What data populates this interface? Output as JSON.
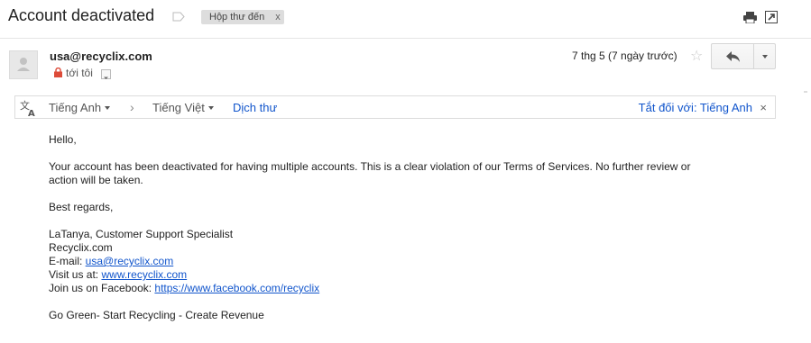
{
  "header": {
    "subject": "Account deactivated",
    "label_chip": "Hộp thư đến",
    "label_chip_close": "x",
    "icons": {
      "label": "label-tag-icon",
      "print": "print-icon",
      "popout": "new-window-icon"
    }
  },
  "message": {
    "sender": "usa@recyclix.com",
    "recipient": "tới tôi",
    "date": "7 thg 5 (7 ngày trước)",
    "star": "☆",
    "icons": {
      "avatar": "person-avatar",
      "lock": "lock-icon",
      "reply": "reply-icon",
      "more": "chevron-down-icon"
    }
  },
  "translate": {
    "from_lang": "Tiếng Anh",
    "arrow": "›",
    "to_lang": "Tiếng Việt",
    "action": "Dịch thư",
    "turn_off": "Tắt đối với: Tiếng Anh",
    "close": "×"
  },
  "body": {
    "greeting": "Hello,",
    "line1": "Your account has been deactivated for having multiple accounts. This is a clear violation of our Terms of Services. No further review or",
    "line2": "action will be taken.",
    "closing": "Best regards,",
    "sig_name": "LaTanya, Customer Support Specialist",
    "sig_company": "Recyclix.com",
    "email_label": "E-mail: ",
    "email_link": "usa@recyclix.com",
    "visit_label": "Visit us at: ",
    "visit_link": "www.recyclix.com",
    "fb_label": "Join us on Facebook: ",
    "fb_link": "https://www.facebook.com/recyclix",
    "tagline": "Go Green-  Start Recycling - Create Revenue"
  },
  "colors": {
    "link": "#1155cc",
    "warning_lock": "#dd4b39",
    "chip_bg": "#dddddd"
  }
}
